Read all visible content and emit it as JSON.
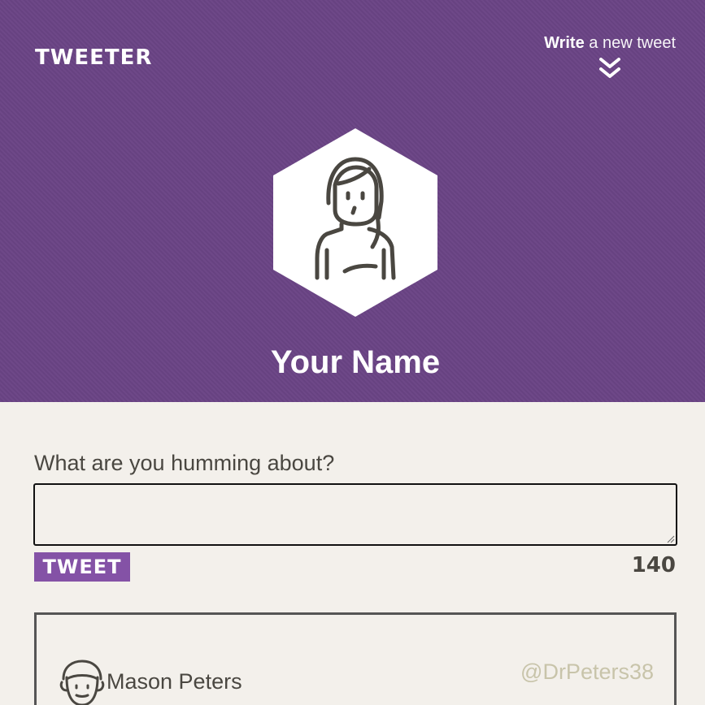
{
  "header": {
    "brand": "TWEETER",
    "write_bold": "Write",
    "write_rest": "a new tweet",
    "profile_name": "Your Name"
  },
  "composer": {
    "prompt": "What are you humming about?",
    "input_value": "",
    "tweet_button": "TWEET",
    "char_count": "140"
  },
  "feed": {
    "tweets": [
      {
        "name": "Mason Peters",
        "handle": "@DrPeters38"
      }
    ]
  },
  "colors": {
    "header_bg": "#6a4485",
    "accent": "#8452a6",
    "page_bg": "#f3f0eb",
    "text": "#4a4741",
    "handle": "#c8c4aa"
  },
  "icons": {
    "write": "double-chevron-down-icon",
    "profile_avatar": "woman-avatar-icon",
    "tweet_avatar": "man-avatar-icon"
  }
}
